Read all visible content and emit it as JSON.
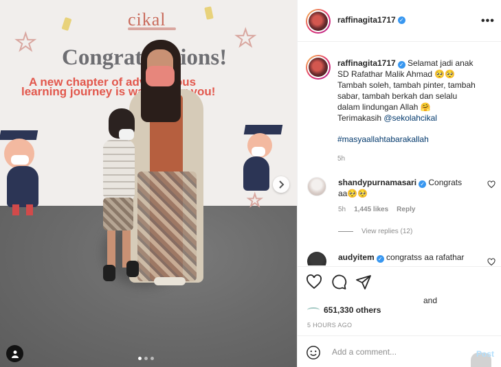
{
  "post": {
    "username": "raffinagita1717",
    "verified_icon": "verified-badge-icon",
    "more_label": "•••"
  },
  "photo": {
    "banner_logo": "cikal",
    "banner_title": "Congratulations!",
    "banner_line1": "A new chapter of adventurous",
    "banner_line2": "learning journey is waiting for you!",
    "next_icon": "chevron-right-icon",
    "tag_icon": "user-tag-icon",
    "carousel_total": 3,
    "carousel_active": 1
  },
  "caption": {
    "username": "raffinagita1717",
    "line1": "Selamat jadi anak",
    "line2": "SD Rafathar Malik Ahmad 🥺🥺",
    "line3": "Tambah soleh, tambah pinter, tambah",
    "line4": "sabar, tambah berkah dan selalu",
    "line5": "dalam lindungan Allah 🤗",
    "line6_prefix": "Terimakasih",
    "mention": "@sekolahcikal",
    "hashtag": "#masyaallahtabarakallah",
    "time": "5h"
  },
  "comments": [
    {
      "username": "shandypurnamasari",
      "text_line1": "Congrats",
      "text_line2": "aa🥺🥺",
      "time": "5h",
      "likes": "1,445 likes",
      "reply": "Reply",
      "view_replies": "View replies (12)"
    },
    {
      "username": "audyitem",
      "text": "congratss aa rafathar"
    }
  ],
  "actions": {
    "like_icon": "heart-icon",
    "comment_icon": "comment-icon",
    "share_icon": "share-icon",
    "and_text": "and",
    "likes_text": "651,330 others",
    "posted_ago": "5 HOURS AGO"
  },
  "composer": {
    "emoji_icon": "emoji-icon",
    "placeholder": "Add a comment...",
    "post_label": "Post"
  },
  "colors": {
    "link": "#00376b",
    "verified": "#3897f0",
    "muted": "#8e8e8e",
    "post_disabled": "#b2dffc",
    "banner_red": "#e2574c"
  }
}
